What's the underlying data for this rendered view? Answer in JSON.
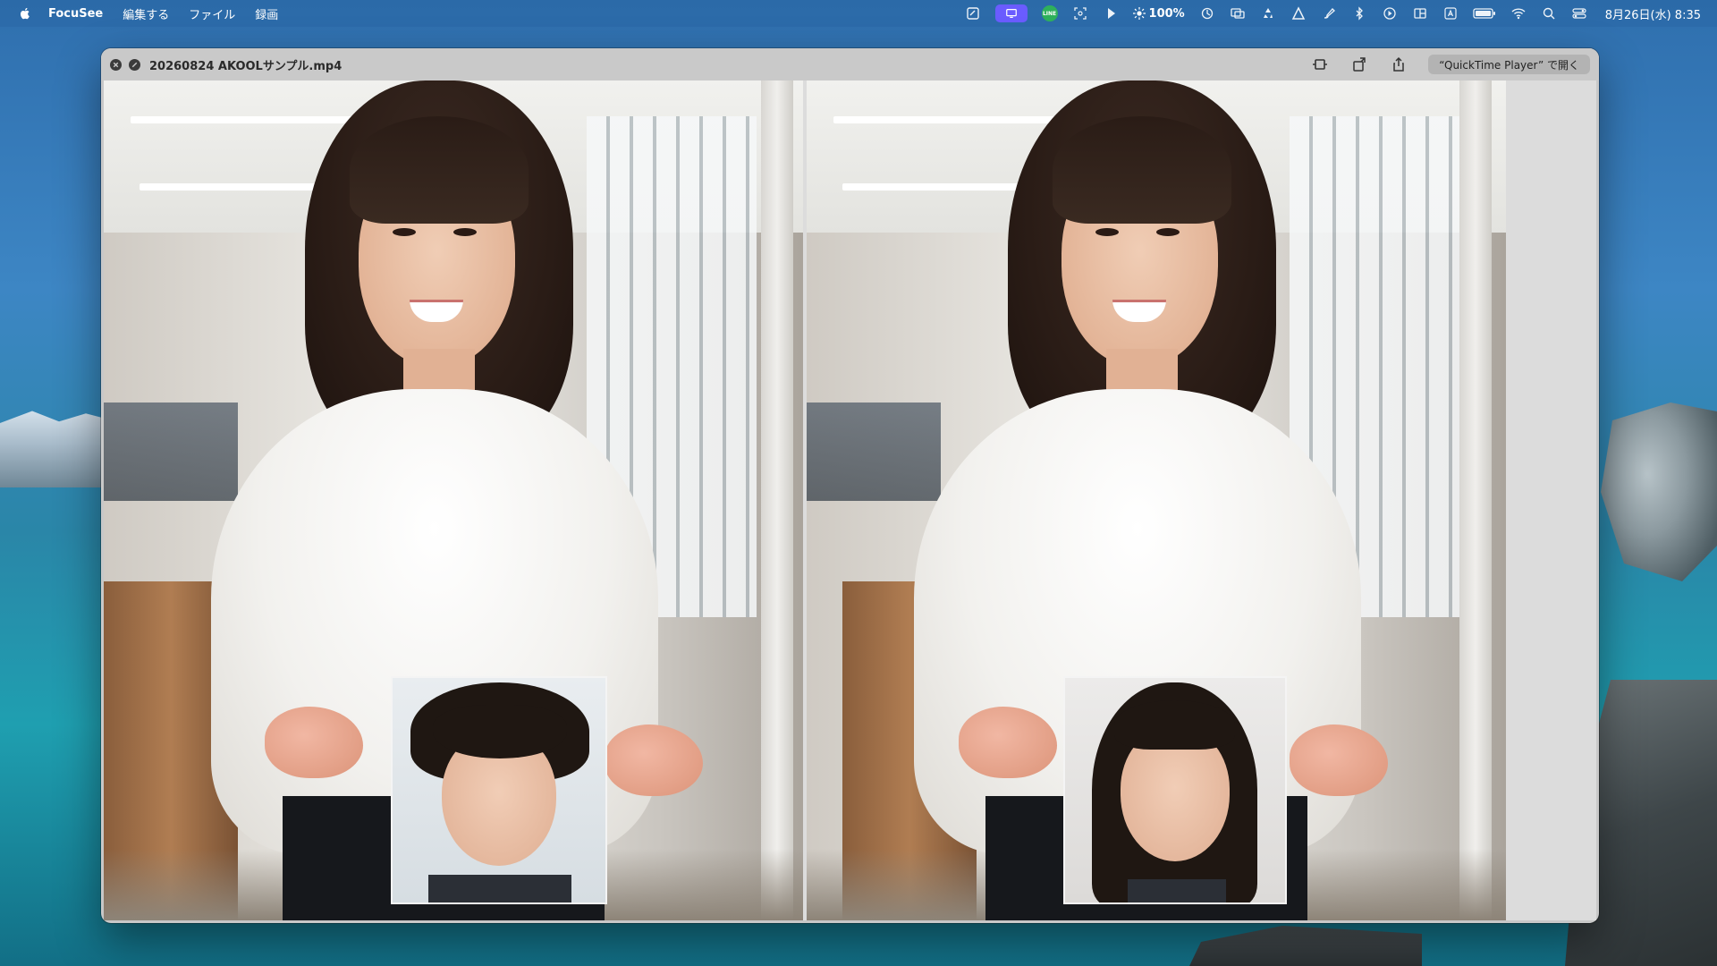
{
  "menubar": {
    "app_name": "FocuSee",
    "menus": [
      "編集する",
      "ファイル",
      "録画"
    ],
    "brightness": "100%",
    "datetime": "8月26日(水) 8:35",
    "badge_green_text": "LINE"
  },
  "window": {
    "title": "20260824 AKOOLサンプル.mp4",
    "open_button_label": "“QuickTime Player” で開く"
  },
  "colors": {
    "menubar_accent": "#6a5cff",
    "window_chrome": "#c9c9c9"
  },
  "icons": [
    "apple-icon",
    "note-icon",
    "screen-record-icon",
    "line-app-icon",
    "scan-icon",
    "play-arrow-icon",
    "brightness-icon",
    "sync-icon",
    "screen-mirror-icon",
    "recycle-icon",
    "delta-icon",
    "brush-icon",
    "bluetooth-icon",
    "play-circle-icon",
    "split-view-icon",
    "input-source-icon",
    "battery-icon",
    "wifi-icon",
    "search-icon",
    "control-center-icon",
    "close-icon",
    "stop-icon",
    "trim-icon",
    "rotate-icon",
    "share-icon"
  ]
}
